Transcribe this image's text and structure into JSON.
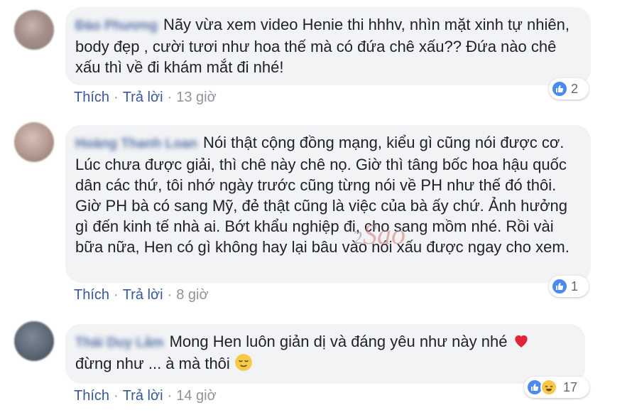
{
  "comments": [
    {
      "author": "Đào Phương",
      "text": "Nãy vừa xem video Henie thi hhhv, nhìn mặt xinh tự nhiên, body đẹp , cười tươi như hoa thế mà có đứa chê xấu?? Đứa nào chê xấu thì về đi khám mắt đi nhé!",
      "like_label": "Thích",
      "reply_label": "Trả lời",
      "time": "13 giờ",
      "reaction_count": "2",
      "reactions": [
        "like-icon"
      ]
    },
    {
      "author": "Hoàng Thanh Loan",
      "text": "Nói thật cộng đồng mạng, kiểu gì cũng nói được cơ. Lúc chưa được giải, thì chê này chê nọ. Giờ thì tâng bốc hoa hậu quốc dân các thứ, tôi nhớ ngày trước cũng từng nói về PH như thế đó thôi. Giờ PH bà có sang Mỹ, đẻ thật cũng là việc của bà ấy chứ. Ảnh hưởng gì đến kinh tế nhà ai. Bớt khẩu nghiệp đi, cho sang mồm nhé. Rồi vài bữa nữa, Hen có gì không hay lại bâu vào nói xấu được ngay cho xem.",
      "like_label": "Thích",
      "reply_label": "Trả lời",
      "time": "8 giờ",
      "reaction_count": "1",
      "reactions": [
        "like-icon"
      ]
    },
    {
      "author": "Thái Duy Lâm",
      "text": "Mong Hen luôn giản dị và đáng yêu như này nhé",
      "text2": "đừng như ... à mà thôi",
      "like_label": "Thích",
      "reply_label": "Trả lời",
      "time": "14 giờ",
      "reaction_count": "17",
      "reactions": [
        "like-icon",
        "haha-icon"
      ]
    }
  ],
  "watermark": {
    "num": "2",
    "brand": "Sao"
  },
  "colors": {
    "bubble": "#f2f3f5",
    "link": "#385898",
    "muted": "#90949c",
    "like": "#4d8af0"
  }
}
